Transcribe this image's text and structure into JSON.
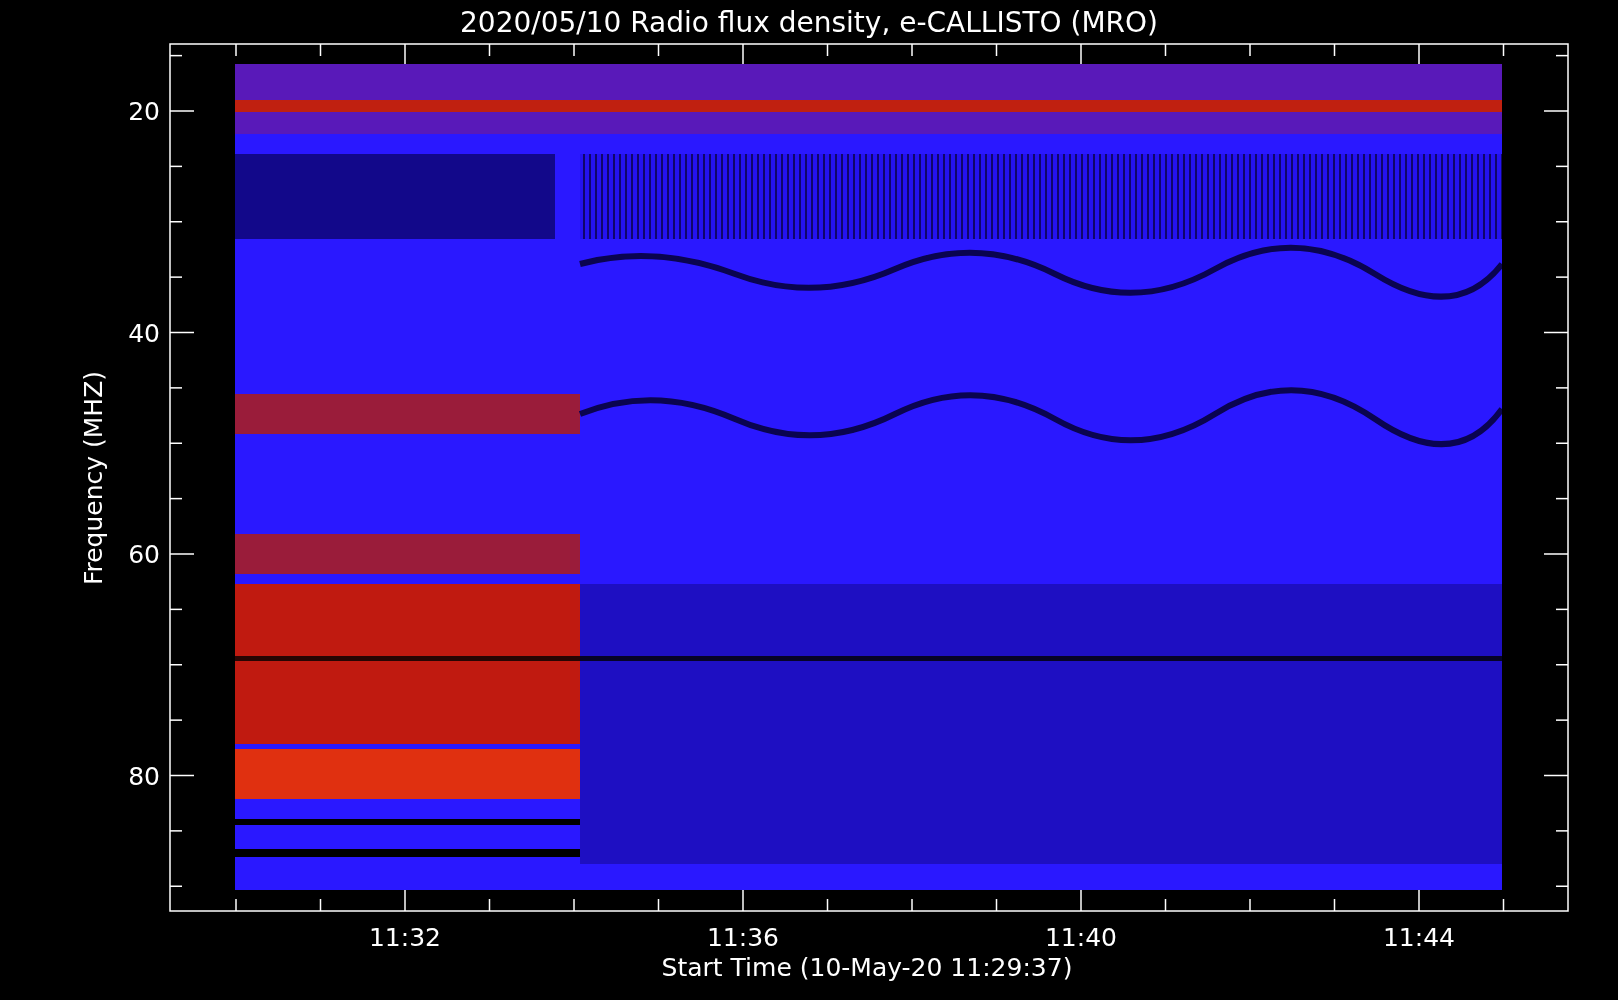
{
  "title": "2020/05/10  Radio flux density, e-CALLISTO (MRO)",
  "y_axis": {
    "label": "Frequency (MHZ)",
    "ticks": [
      "20",
      "40",
      "60",
      "80"
    ]
  },
  "x_axis": {
    "label": "Start Time (10-May-20 11:29:37)",
    "ticks": [
      "11:32",
      "11:36",
      "11:40",
      "11:44"
    ]
  }
}
